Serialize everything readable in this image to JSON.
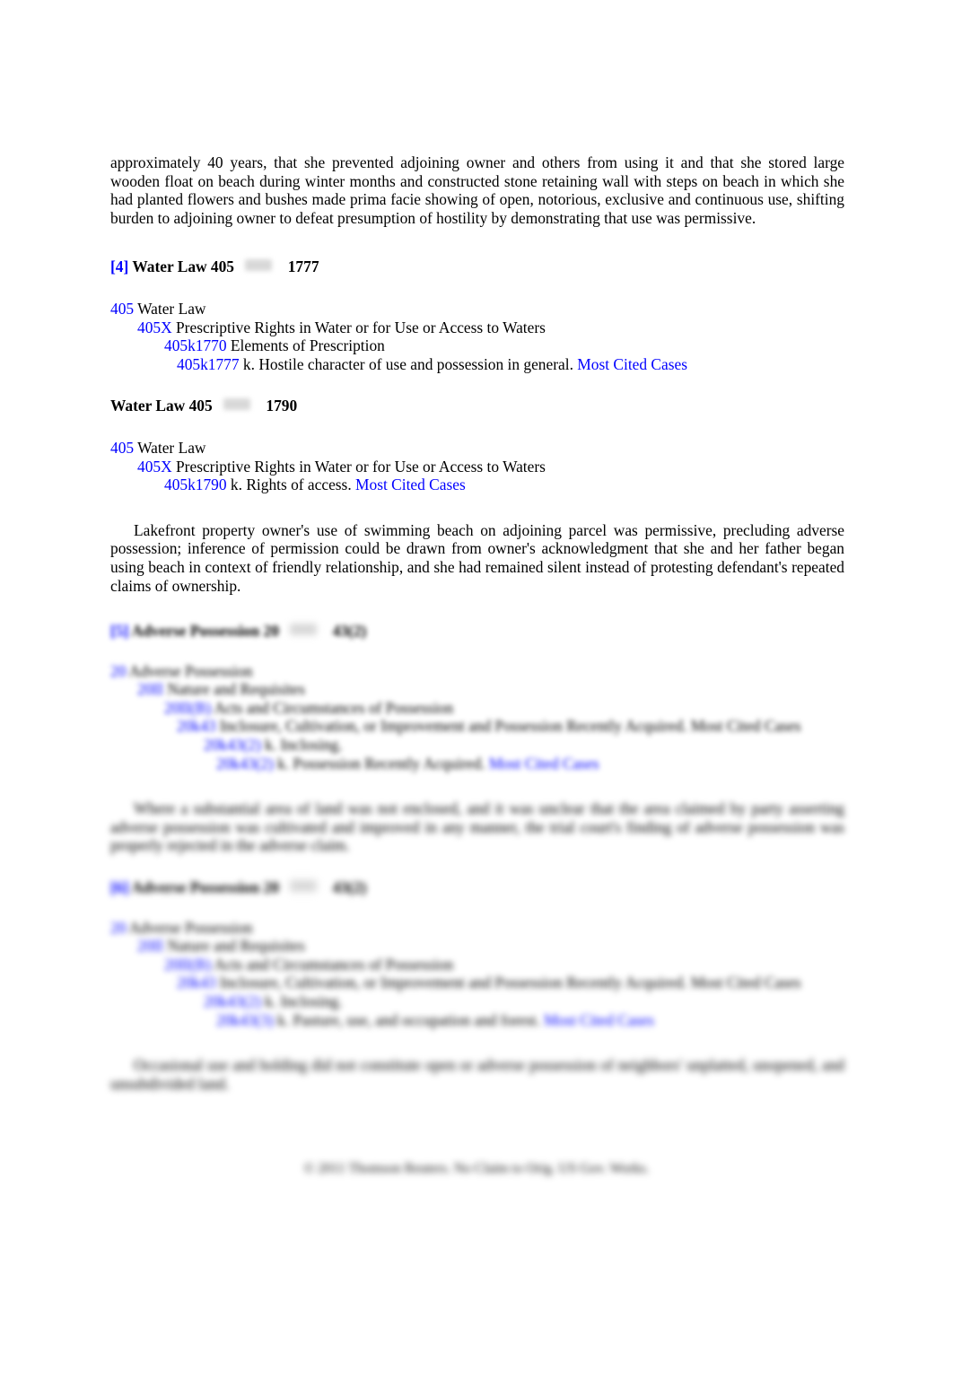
{
  "document": {
    "type": "legal-headnote-page",
    "link_color": "#0000ff",
    "text_color": "#000000"
  },
  "lead_paragraph": {
    "text": "approximately 40 years, that she prevented adjoining owner and others from using it and that she stored large wooden float on beach during winter months and constructed stone retaining wall with steps on beach in which she had planted flowers and bushes made prima facie showing of open, notorious, exclusive and continuous use, shifting burden to adjoining owner to defeat presumption of hostility by demonstrating that use was permissive."
  },
  "headnote_4": {
    "tag": "[4]",
    "topic": "Water Law 405",
    "key_symbol": "key-symbol",
    "number": "1777",
    "outline": [
      {
        "code": "405",
        "label": "Water Law",
        "level": 0
      },
      {
        "code": "405X",
        "label": "Prescriptive Rights in Water or for Use or Access to Waters",
        "level": 1
      },
      {
        "code": "405k1770",
        "label": "Elements of Prescription",
        "level": 2
      },
      {
        "code": "405k1777",
        "label": "k. Hostile character of use and possession in general.",
        "level": 3,
        "link": "Most Cited Cases"
      }
    ]
  },
  "headnote_5": {
    "tag": "",
    "topic": "Water Law 405",
    "key_symbol": "key-symbol",
    "number": "1790",
    "outline": [
      {
        "code": "405",
        "label": "Water Law",
        "level": 0
      },
      {
        "code": "405X",
        "label": "Prescriptive Rights in Water or for Use or Access to Waters",
        "level": 1
      },
      {
        "code": "405k1790",
        "label": "k. Rights of access.",
        "level": 2,
        "link": "Most Cited Cases"
      }
    ]
  },
  "summary_paragraph": {
    "text": "Lakefront property owner's use of swimming beach on adjoining parcel was permissive, precluding adverse possession; inference of permission could be drawn from owner's acknowledgment that she and her father began using beach in context of friendly relationship, and she had remained silent instead of protesting defendant's repeated claims of ownership."
  },
  "headnote_6": {
    "tag": "[5]",
    "topic": "Adverse Possession 20",
    "key_symbol": "key-symbol",
    "number": "43(2)",
    "outline": [
      {
        "code": "20",
        "label": "Adverse Possession",
        "level": 0
      },
      {
        "code": "20II",
        "label": "Nature and Requisites",
        "level": 1
      },
      {
        "code": "20II(B)",
        "label": "Acts and Circumstances of Possession",
        "level": 2
      },
      {
        "code": "20k43",
        "label": "Inclosure, Cultivation, or Improvement and Possession Recently Acquired. Most Cited Cases",
        "level": 3
      },
      {
        "code": "20k43(2)",
        "label": "k. Inclosing.",
        "level": 3
      },
      {
        "code": "20k43(2)",
        "label": "k. Possession Recently Acquired.",
        "level": 3,
        "link": "Most Cited Cases"
      }
    ]
  },
  "blurred_paragraph_1": {
    "text": "Where a substantial area of land was not enclosed, and it was unclear that the area claimed by party asserting adverse possession was cultivated and improved in any manner, the trial court's finding of adverse possession was properly rejected in the adverse claim."
  },
  "headnote_7": {
    "tag": "[6]",
    "topic": "Adverse Possession 20",
    "key_symbol": "key-symbol",
    "number": "43(2)",
    "outline": [
      {
        "code": "20",
        "label": "Adverse Possession",
        "level": 0
      },
      {
        "code": "20II",
        "label": "Nature and Requisites",
        "level": 1
      },
      {
        "code": "20II(B)",
        "label": "Acts and Circumstances of Possession",
        "level": 2
      },
      {
        "code": "20k43",
        "label": "Inclosure, Cultivation, or Improvement and Possession Recently Acquired. Most Cited Cases",
        "level": 3
      },
      {
        "code": "20k43(2)",
        "label": "k. Inclosing.",
        "level": 3
      },
      {
        "code": "20k43(3)",
        "label": "k. Pasture, use, and occupation and forest.",
        "level": 3,
        "link": "Most Cited Cases"
      }
    ]
  },
  "blurred_paragraph_2": {
    "text": "Occasional use and holding did not constitute open or adverse possession of neighbors' unplatted, unopened, and unsubdivided land."
  },
  "footer": {
    "text": "© 2011 Thomson Reuters. No Claim to Orig. US Gov. Works."
  }
}
